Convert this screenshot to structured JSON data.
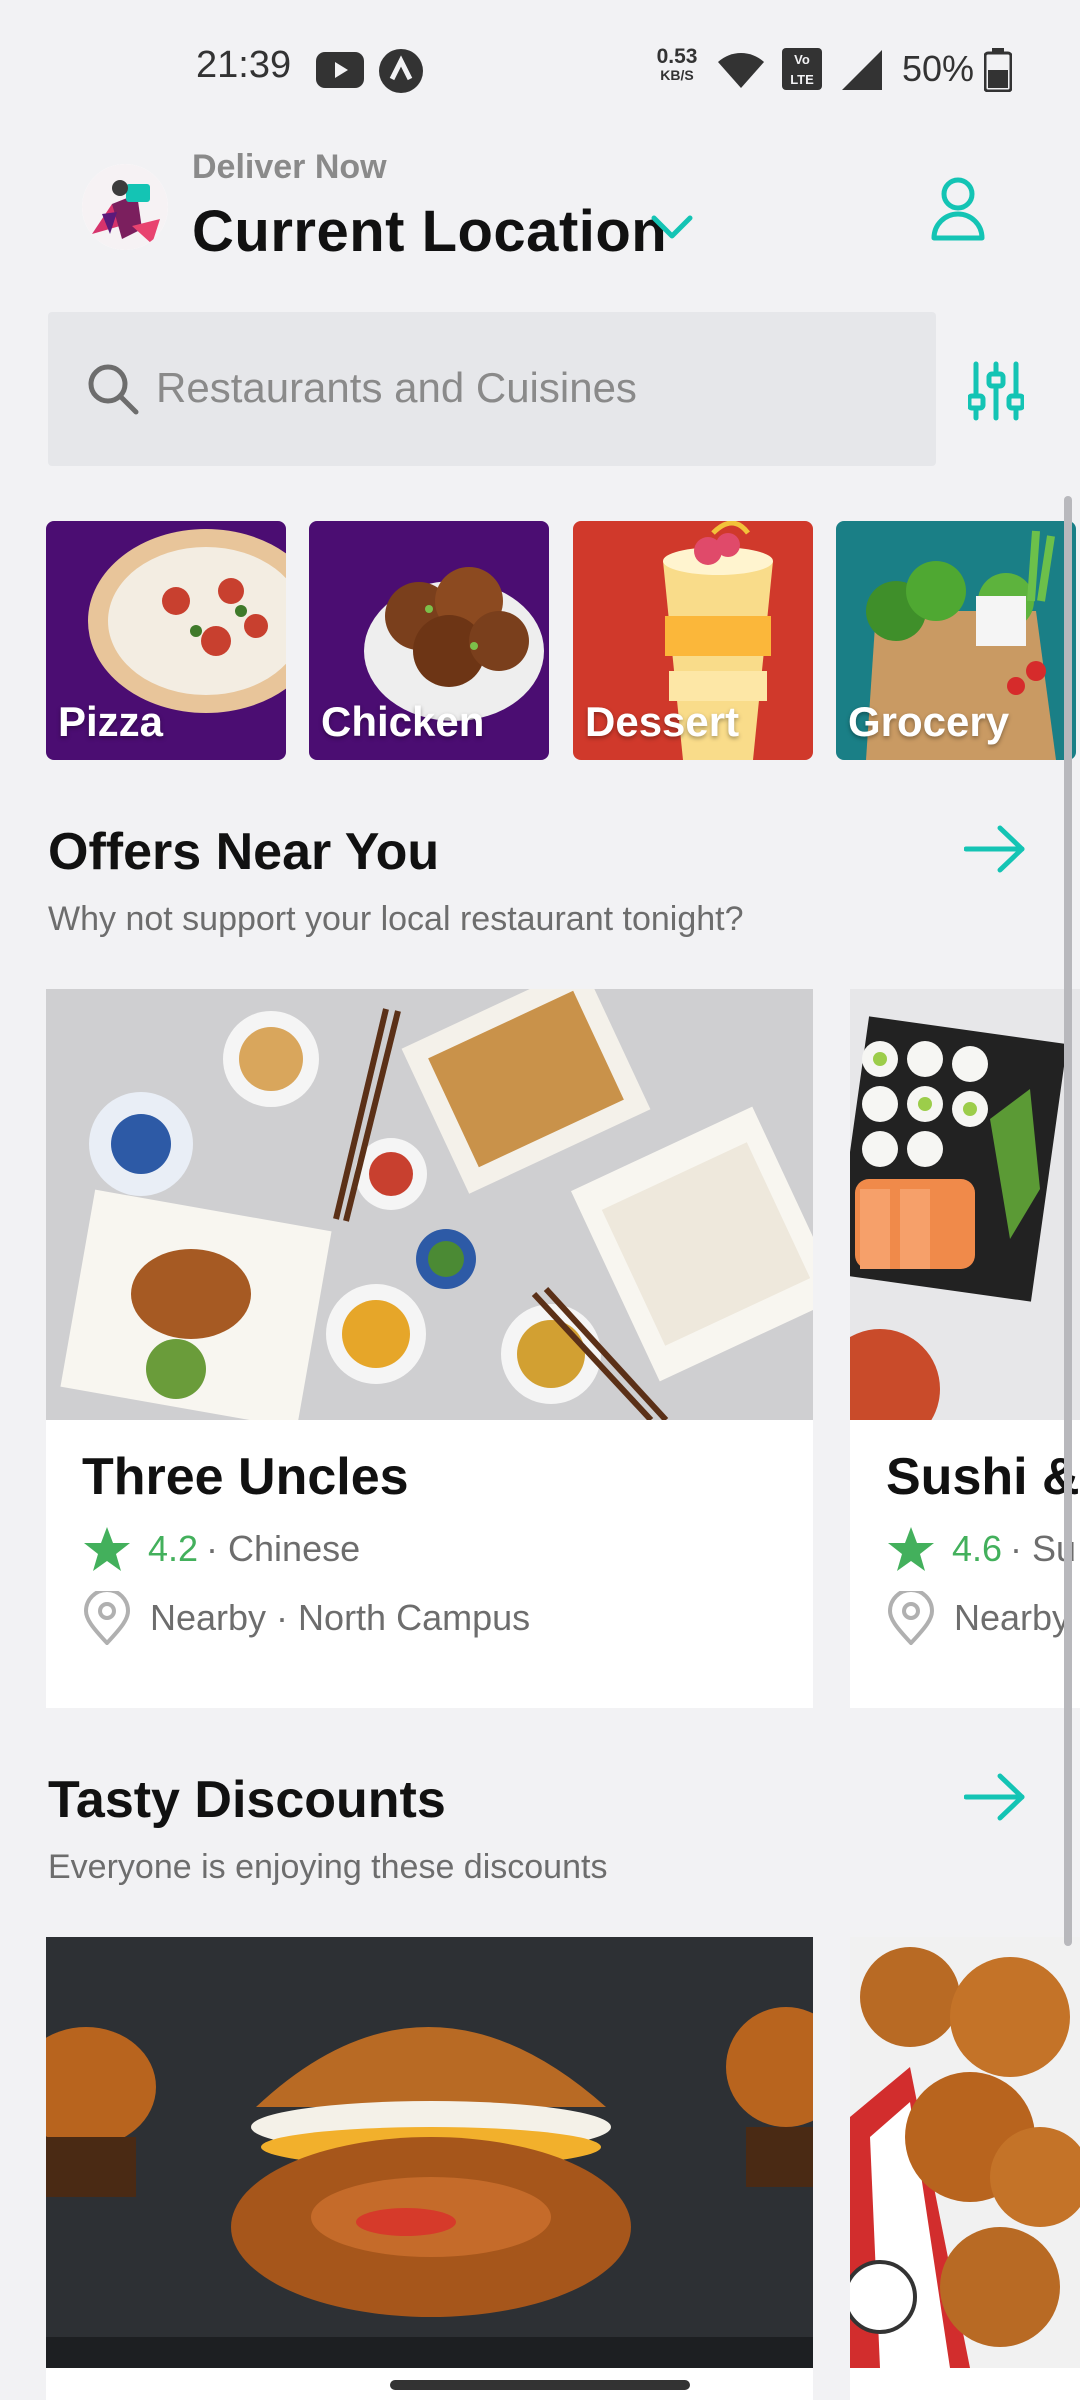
{
  "status_bar": {
    "time": "21:39",
    "speed_value": "0.53",
    "speed_unit": "KB/S",
    "volte": "Vo LTE",
    "battery": "50%"
  },
  "header": {
    "deliver_label": "Deliver Now",
    "location": "Current Location",
    "icons": [
      "chevron-down-icon",
      "user-icon"
    ]
  },
  "search": {
    "placeholder": "Restaurants and Cuisines",
    "icons": [
      "search-icon",
      "filter-sliders-icon"
    ]
  },
  "categories": [
    {
      "label": "Pizza",
      "color": "#4b0d72"
    },
    {
      "label": "Chicken",
      "color": "#4b0d72"
    },
    {
      "label": "Dessert",
      "color": "#d0392b"
    },
    {
      "label": "Grocery",
      "color": "#1a7f86"
    }
  ],
  "offers": {
    "title": "Offers Near You",
    "subtitle": "Why not support your local restaurant tonight?",
    "restaurants": [
      {
        "name": "Three Uncles",
        "rating": "4.2",
        "cuisine": "· Chinese",
        "location": "Nearby · North Campus"
      },
      {
        "name": "Sushi &",
        "rating": "4.6",
        "cuisine": "· Su",
        "location": "Nearby"
      }
    ]
  },
  "discounts": {
    "title": "Tasty Discounts",
    "subtitle": "Everyone is enjoying these discounts"
  },
  "colors": {
    "accent": "#14c4b4",
    "rating_green": "#43b05c",
    "background": "#f2f2f4"
  }
}
